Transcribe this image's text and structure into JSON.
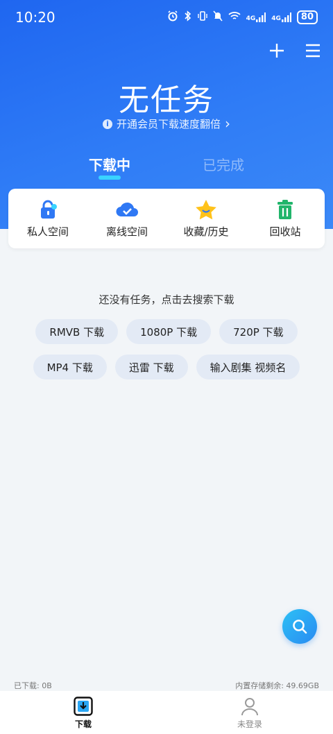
{
  "status_bar": {
    "time": "10:20",
    "signal_1": "4G",
    "signal_2": "4G",
    "battery": "80",
    "icons": [
      "alarm-icon",
      "bluetooth-icon",
      "vibrate-icon",
      "mute-icon",
      "wifi-icon",
      "signal-icon",
      "signal-icon",
      "battery-icon"
    ]
  },
  "header": {
    "add_icon": "plus-icon",
    "menu_icon": "menu-icon",
    "title": "无任务",
    "vip_link": "开通会员下载速度翻倍",
    "vip_arrow": "›"
  },
  "tabs": [
    {
      "label": "下载中",
      "active": true
    },
    {
      "label": "已完成",
      "active": false
    }
  ],
  "features": [
    {
      "label": "私人空间",
      "icon": "lock-icon"
    },
    {
      "label": "离线空间",
      "icon": "cloud-check-icon"
    },
    {
      "label": "收藏/历史",
      "icon": "star-icon"
    },
    {
      "label": "回收站",
      "icon": "trash-icon"
    }
  ],
  "empty_state": {
    "message": "还没有任务，点击去搜索下载",
    "chips_row_1": [
      "RMVB 下载",
      "1080P 下载",
      "720P 下载"
    ],
    "chips_row_2": [
      "MP4 下载",
      "迅雷 下载",
      "输入剧集 视频名"
    ]
  },
  "fab": {
    "icon": "search-icon"
  },
  "storage": {
    "downloaded": "已下载: 0B",
    "remaining": "内置存储剩余: 49.69GB"
  },
  "bottom_nav": [
    {
      "label": "下载",
      "icon": "download-icon",
      "active": true
    },
    {
      "label": "未登录",
      "icon": "user-icon",
      "active": false
    }
  ],
  "colors": {
    "primary": "#2f78f4",
    "accent": "#39d3ff",
    "chip_bg": "#e3eaf5",
    "page_bg": "#f2f5f8"
  }
}
